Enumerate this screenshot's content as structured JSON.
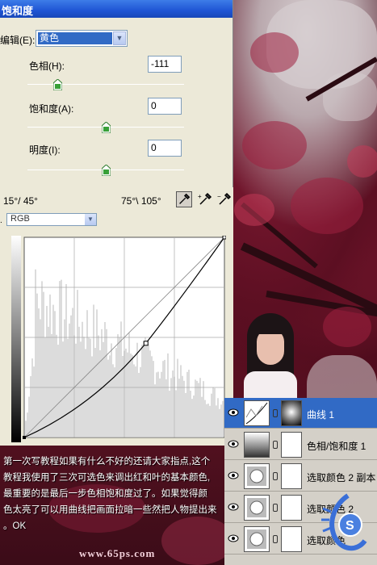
{
  "hue_saturation": {
    "title": "饱和度",
    "edit_label": "编辑(E):",
    "edit_value": "黄色",
    "hue_label": "色相(H):",
    "hue_value": "-111",
    "saturation_label": "饱和度(A):",
    "saturation_value": "0",
    "lightness_label": "明度(I):",
    "lightness_value": "0",
    "range_left": "15°/ 45°",
    "range_right": "75°\\ 105°",
    "hue_slider_pos": 0.19,
    "saturation_slider_pos": 0.5,
    "lightness_slider_pos": 0.5
  },
  "curves": {
    "channel": "RGB",
    "control_point": {
      "input": 155,
      "output": 120
    }
  },
  "layers": [
    {
      "name": "曲线 1",
      "selected": true,
      "thumb": "curves-icon"
    },
    {
      "name": "色相/饱和度 1",
      "selected": false,
      "thumb": "hue-sat-icon"
    },
    {
      "name": "选取颜色 2 副本",
      "selected": false,
      "thumb": "selective-color-icon"
    },
    {
      "name": "选取颜色 2",
      "selected": false,
      "thumb": "selective-color-icon"
    },
    {
      "name": "选取颜色",
      "selected": false,
      "thumb": "selective-color-icon"
    }
  ],
  "caption": {
    "line1": "第一次写教程如果有什么不好的还请大家指点,这个",
    "line2": "教程我使用了三次可选色来调出红和叶的基本颜色,",
    "line3": "最重要的是最后一步色相饱和度过了。如果觉得颜",
    "line4": "色太亮了可以用曲线把画面拉暗一些然把人物提出来",
    "line5": "。OK"
  },
  "footer": {
    "site": "www.65ps.com"
  },
  "colors": {
    "selection": "#316ac5",
    "dialog_bg": "#ece9d8",
    "photo_red": "#7a1830"
  }
}
